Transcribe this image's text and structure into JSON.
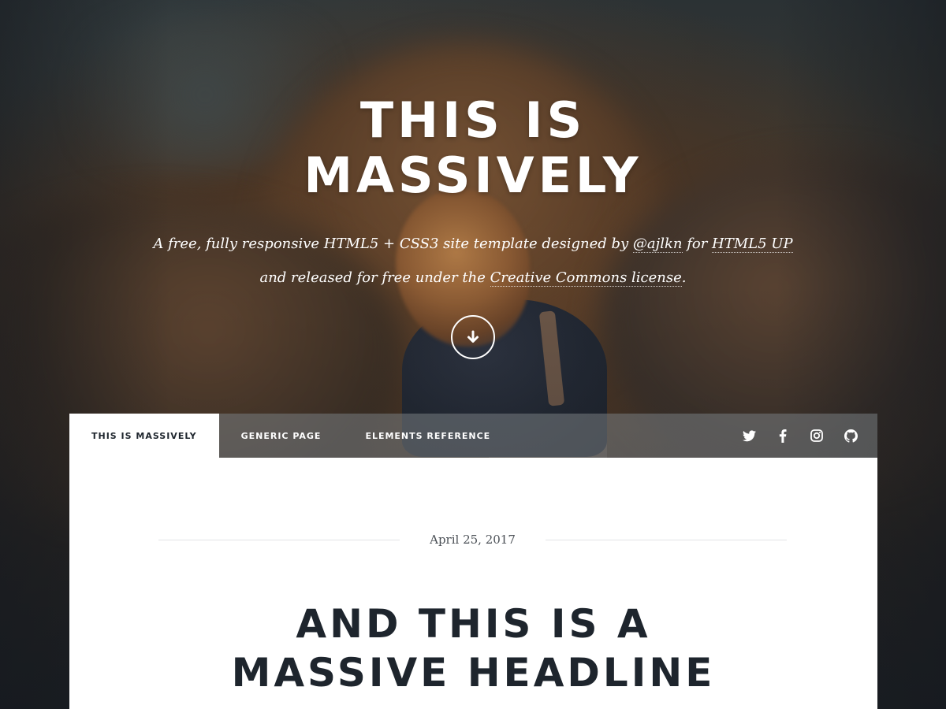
{
  "intro": {
    "title_line1": "THIS IS",
    "title_line2": "MASSIVELY",
    "desc_part1": "A free, fully responsive HTML5 + CSS3 site template designed by ",
    "desc_link_author": "@ajlkn",
    "desc_part2": " for ",
    "desc_link_site": "HTML5 UP",
    "desc_part3": "and released for free under the ",
    "desc_link_license": "Creative Commons license",
    "desc_part4": ".",
    "scroll_icon": "arrow-down-circle-icon"
  },
  "nav": {
    "tabs": [
      {
        "label": "THIS IS MASSIVELY",
        "active": true
      },
      {
        "label": "GENERIC PAGE",
        "active": false
      },
      {
        "label": "ELEMENTS REFERENCE",
        "active": false
      }
    ],
    "social": [
      "twitter-icon",
      "facebook-icon",
      "instagram-icon",
      "github-icon"
    ]
  },
  "post": {
    "date": "April 25, 2017",
    "headline_line1": "AND THIS IS A",
    "headline_line2": "MASSIVE HEADLINE"
  },
  "colors": {
    "accent_dark": "#1e252d",
    "panel": "#ffffff",
    "nav_bg": "rgba(120,125,130,0.55)"
  }
}
